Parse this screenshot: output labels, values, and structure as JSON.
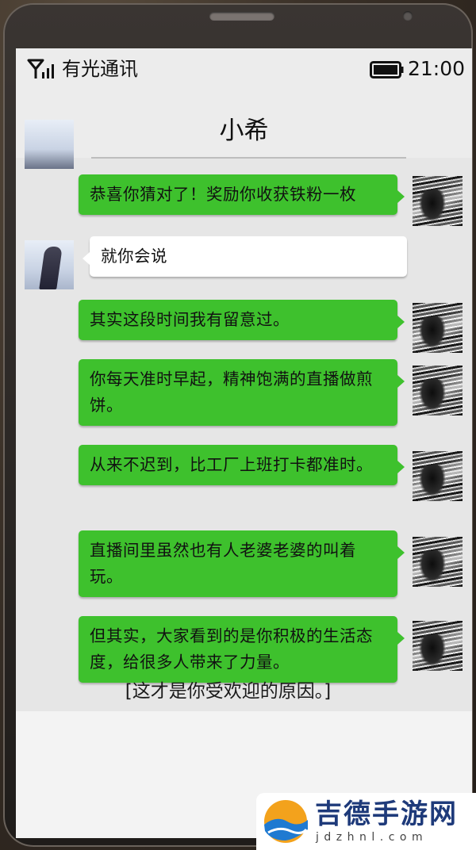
{
  "status_bar": {
    "carrier": "有光通讯",
    "time": "21:00",
    "signal_icon": "signal-icon",
    "battery_icon": "battery-icon"
  },
  "chat": {
    "title": "小希",
    "messages": [
      {
        "side": "right",
        "text": "恭喜你猜对了！奖励你收获铁粉一枚"
      },
      {
        "side": "left",
        "text": "就你会说"
      },
      {
        "side": "right",
        "text": "其实这段时间我有留意过。"
      },
      {
        "side": "right",
        "text": "你每天准时早起，精神饱满的直播做煎饼。"
      },
      {
        "side": "right",
        "text": "从来不迟到，比工厂上班打卡都准时。"
      },
      {
        "side": "right",
        "text": "直播间里虽然也有人老婆老婆的叫着玩。"
      },
      {
        "side": "right",
        "text": "但其实，大家看到的是你积极的生活态度，给很多人带来了力量。"
      }
    ]
  },
  "narration": "[这才是你受欢迎的原因。]",
  "watermark": {
    "name": "吉德手游网",
    "url": "jdzhnl.com"
  },
  "colors": {
    "bubble_right": "#3ec12d",
    "bubble_left": "#ffffff",
    "screen_bg": "#e6e6e6"
  }
}
